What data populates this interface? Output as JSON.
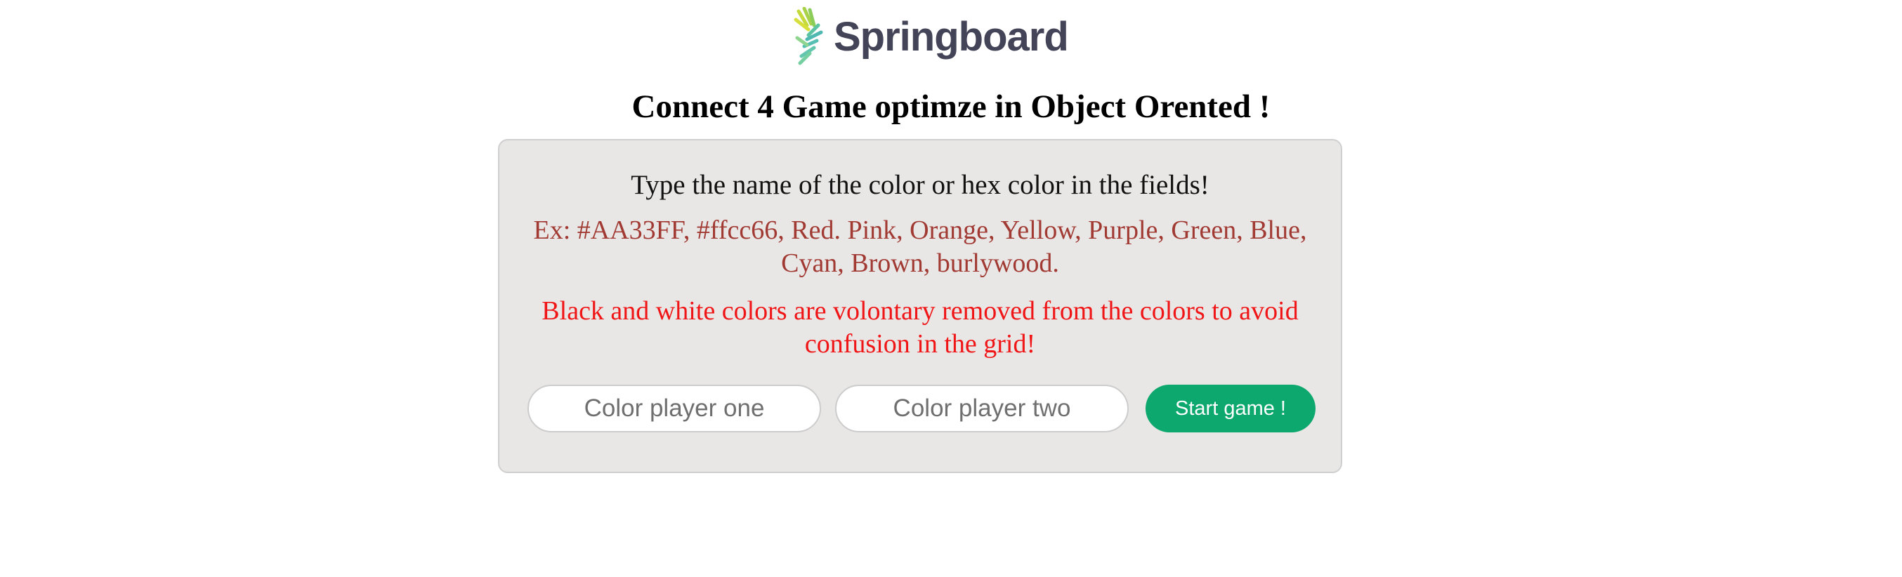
{
  "brand": {
    "name": "Springboard",
    "logo_icon": "springboard-leaf-icon",
    "text_color": "#434458"
  },
  "page": {
    "title": "Connect 4 Game optimze in Object Orented !"
  },
  "setup": {
    "instruction": "Type the name of the color or hex color in the fields!",
    "examples": "Ex: #AA33FF, #ffcc66, Red. Pink, Orange, Yellow, Purple, Green, Blue, Cyan, Brown, burlywood.",
    "warning": "Black and white colors are volontary removed from the colors to avoid confusion in the grid!",
    "player_one": {
      "value": "",
      "placeholder": "Color player one"
    },
    "player_two": {
      "value": "",
      "placeholder": "Color player two"
    },
    "start_label": "Start game !"
  },
  "colors": {
    "panel_background": "#e9e7e6",
    "examples_text": "#a13a33",
    "warning_text": "#f01516",
    "start_button": "#0da86e"
  }
}
